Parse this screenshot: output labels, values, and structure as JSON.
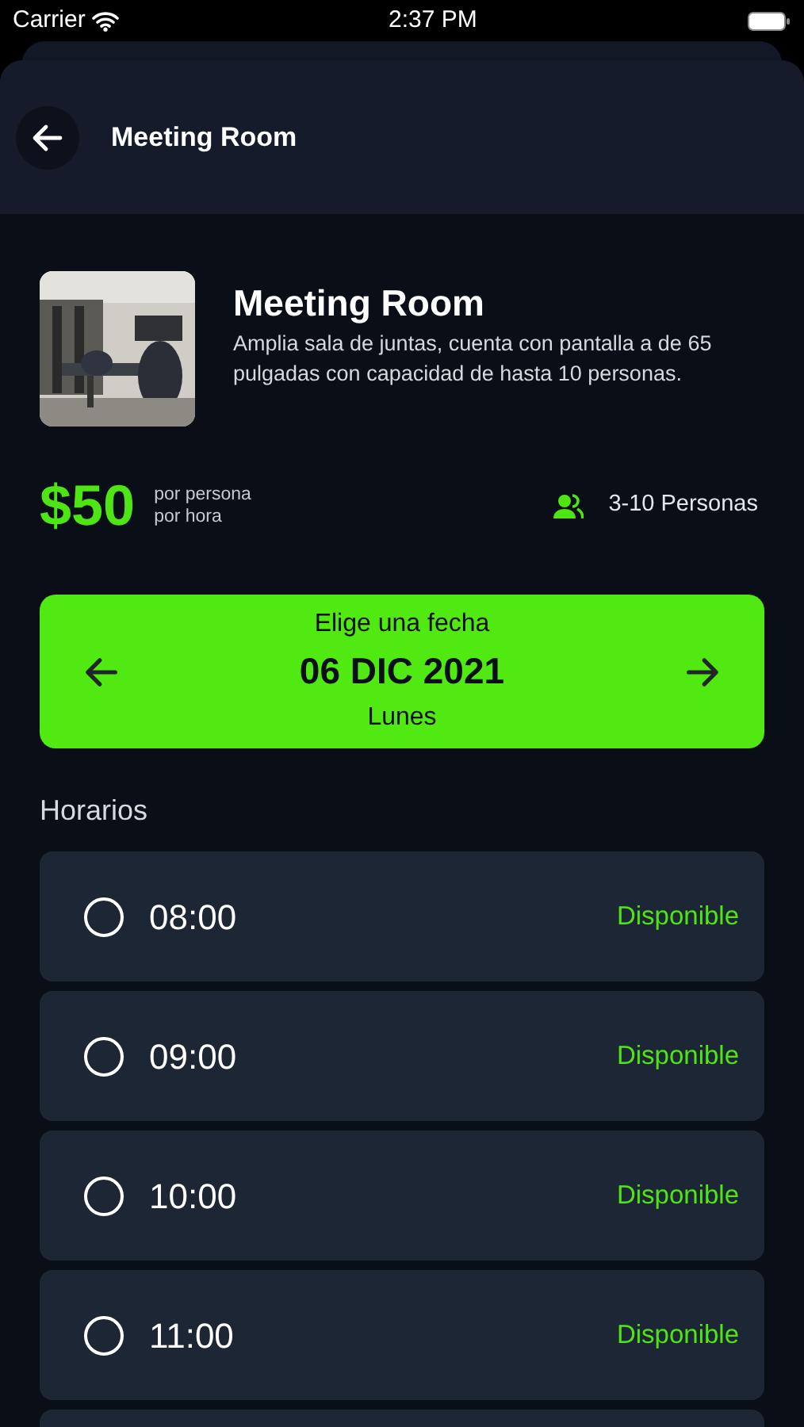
{
  "status_bar": {
    "carrier": "Carrier",
    "time": "2:37 PM"
  },
  "header": {
    "title": "Meeting Room"
  },
  "room": {
    "name": "Meeting Room",
    "description": "Amplia sala de juntas, cuenta con pantalla a de 65 pulgadas con capacidad de hasta 10 personas."
  },
  "price": {
    "amount": "$50",
    "unit_lines": [
      "por persona",
      "por hora"
    ],
    "capacity": "3-10 Personas"
  },
  "date_picker": {
    "label": "Elige una fecha",
    "date": "06 DIC 2021",
    "weekday": "Lunes"
  },
  "schedule": {
    "title": "Horarios",
    "slots": [
      {
        "time": "08:00",
        "status": "Disponible",
        "selected": false
      },
      {
        "time": "09:00",
        "status": "Disponible",
        "selected": false
      },
      {
        "time": "10:00",
        "status": "Disponible",
        "selected": false
      },
      {
        "time": "11:00",
        "status": "Disponible",
        "selected": false
      }
    ]
  }
}
